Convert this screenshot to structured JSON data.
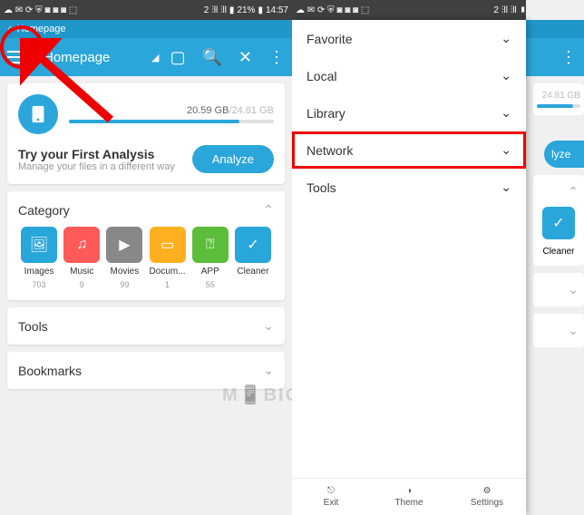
{
  "status": {
    "battery": "21%",
    "time": "14:57",
    "sim": "2"
  },
  "breadcrumb": {
    "home_icon": "⌂",
    "label": "Homepage"
  },
  "header": {
    "title": "Homepage"
  },
  "storage": {
    "used": "20.59 GB",
    "total": "24.81 GB",
    "separator": "/"
  },
  "analysis": {
    "title": "Try your First Analysis",
    "sub": "Manage your files in a different way",
    "button": "Analyze"
  },
  "category": {
    "title": "Category",
    "items": [
      {
        "label": "Images",
        "count": "703",
        "color": "#29a6da"
      },
      {
        "label": "Music",
        "count": "9",
        "color": "#ff5a5a"
      },
      {
        "label": "Movies",
        "count": "99",
        "color": "#888"
      },
      {
        "label": "Docum...",
        "count": "1",
        "color": "#ffb020"
      },
      {
        "label": "APP",
        "count": "55",
        "color": "#5bbd3a"
      },
      {
        "label": "Cleaner",
        "count": "",
        "color": "#29a6da"
      }
    ]
  },
  "panels": {
    "tools": "Tools",
    "bookmarks": "Bookmarks"
  },
  "drawer": {
    "items": [
      {
        "label": "Favorite"
      },
      {
        "label": "Local"
      },
      {
        "label": "Library"
      },
      {
        "label": "Network"
      },
      {
        "label": "Tools"
      }
    ],
    "bottom": {
      "exit": "Exit",
      "theme": "Theme",
      "settings": "Settings"
    }
  },
  "watermark": "M📱BIGYAAN"
}
